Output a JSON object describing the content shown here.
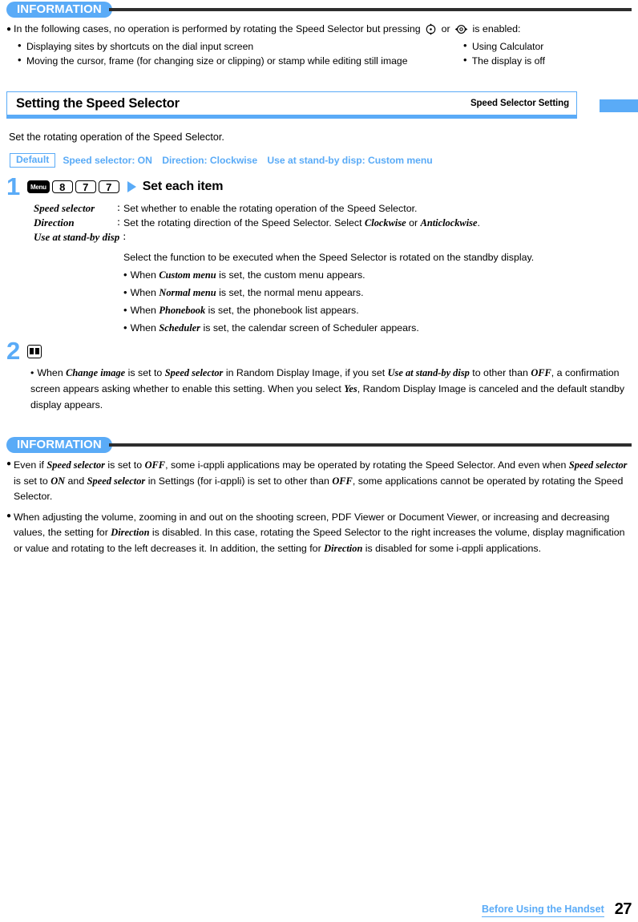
{
  "top_information": {
    "badge": "INFORMATION",
    "main_bullet_pre": "In the following cases, no operation is performed by rotating the Speed Selector but pressing",
    "icon_1": "updown-circle-key-icon",
    "conjunction": "or",
    "icon_2": "leftright-circle-key-icon",
    "main_bullet_post": "is enabled:",
    "items_left": [
      "Displaying sites by shortcuts on the dial input screen",
      "Moving the cursor, frame (for changing size or clipping) or stamp while editing still image"
    ],
    "items_right": [
      "Using Calculator",
      "The display is off"
    ]
  },
  "section": {
    "title": "Setting the Speed Selector",
    "subtitle": "Speed Selector Setting",
    "intro": "Set the rotating operation of the Speed Selector.",
    "default_label": "Default",
    "default_values": [
      "Speed selector: ON",
      "Direction: Clockwise",
      "Use at stand-by disp: Custom menu"
    ]
  },
  "step1": {
    "number": "1",
    "keys": [
      "Menu",
      "8",
      "7",
      "7"
    ],
    "arrow": "play-arrow-icon",
    "action": "Set each item",
    "definitions": [
      {
        "term": "Speed selector",
        "colon": "∶",
        "desc_plain": "Set whether to enable the rotating operation of the Speed Selector."
      },
      {
        "term": "Direction",
        "colon": "∶",
        "desc_pre": "Set the rotating direction of the Speed Selector. Select ",
        "desc_em1": "Clockwise",
        "desc_mid": " or ",
        "desc_em2": "Anticlockwise",
        "desc_post": "."
      },
      {
        "term": "Use at stand-by disp",
        "colon": "∶",
        "desc_plain": ""
      }
    ],
    "standby_intro": "Select the function to be executed when the Speed Selector is rotated on the standby display.",
    "standby_items": [
      {
        "pre": "When ",
        "em": "Custom menu",
        "post": " is set, the custom menu appears."
      },
      {
        "pre": "When ",
        "em": "Normal menu",
        "post": " is set, the normal menu appears."
      },
      {
        "pre": "When ",
        "em": "Phonebook",
        "post": " is set, the phonebook list appears."
      },
      {
        "pre": "When ",
        "em": "Scheduler",
        "post": " is set, the calendar screen of Scheduler appears."
      }
    ]
  },
  "step2": {
    "number": "2",
    "key_icon": "open-book-select-key-icon",
    "note": {
      "p1": "When ",
      "em1": "Change image",
      "p2": " is set to ",
      "em2": "Speed selector",
      "p3": " in Random Display Image, if you set ",
      "em3": "Use at stand-by disp",
      "p4": " to other than ",
      "em4": "OFF",
      "p5": ", a confirmation screen appears asking whether to enable this setting. When you select ",
      "em5": "Yes",
      "p6": ", Random Display Image is canceled and the default standby display appears."
    }
  },
  "bottom_information": {
    "badge": "INFORMATION",
    "paragraph1": {
      "p1": "Even if ",
      "em1": "Speed selector",
      "p2": " is set to ",
      "em2": "OFF",
      "p3": ", some i-αppli applications may be operated by rotating the Speed Selector. And even when ",
      "em3": "Speed selector",
      "p4": " is set to ",
      "em4": "ON",
      "p5": " and ",
      "em5": "Speed selector",
      "p6": " in Settings (for i-αppli) is set to other than ",
      "em6": "OFF",
      "p7": ", some applications cannot be operated by rotating the Speed Selector."
    },
    "paragraph2": {
      "p1": "When adjusting the volume, zooming in and out on the shooting screen, PDF Viewer or Document Viewer, or increasing and decreasing values, the setting for ",
      "em1": "Direction",
      "p2": " is disabled. In this case, rotating the Speed Selector to the right increases the volume, display magnification or value and rotating to the left decreases it. In addition, the setting for ",
      "em2": "Direction",
      "p3": " is disabled for some i-αppli applications."
    }
  },
  "footer": {
    "chapter": "Before Using the Handset",
    "page_number": "27"
  },
  "colors": {
    "accent_blue": "#5aabf7",
    "rule_dark": "#2e2e2e"
  }
}
